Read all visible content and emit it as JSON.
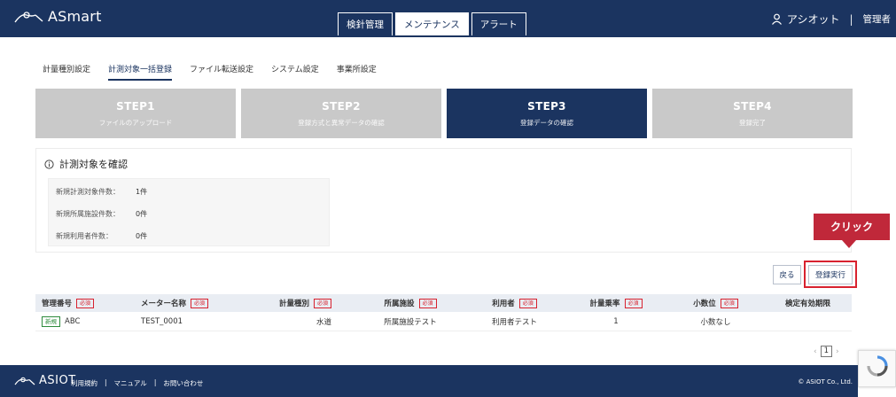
{
  "header": {
    "logo_text": "ASmart",
    "tabs": [
      {
        "label": "検針管理",
        "active": false
      },
      {
        "label": "メンテナンス",
        "active": true
      },
      {
        "label": "アラート",
        "active": false
      }
    ],
    "user_name": "アシオット",
    "separator": "|",
    "user_role": "管理者"
  },
  "subnav": {
    "items": [
      {
        "label": "計量種別設定",
        "active": false
      },
      {
        "label": "計測対象一括登録",
        "active": true
      },
      {
        "label": "ファイル転送設定",
        "active": false
      },
      {
        "label": "システム設定",
        "active": false
      },
      {
        "label": "事業所設定",
        "active": false
      }
    ]
  },
  "steps": [
    {
      "title": "STEP1",
      "subtitle": "ファイルのアップロード",
      "active": false
    },
    {
      "title": "STEP2",
      "subtitle": "登録方式と異常データの確認",
      "active": false
    },
    {
      "title": "STEP3",
      "subtitle": "登録データの確認",
      "active": true
    },
    {
      "title": "STEP4",
      "subtitle": "登録完了",
      "active": false
    }
  ],
  "confirm": {
    "title": "計測対象を確認",
    "rows": [
      {
        "label": "新規計測対象件数：",
        "value": "1件"
      },
      {
        "label": "新規所属施設件数：",
        "value": "0件"
      },
      {
        "label": "新規利用者件数：",
        "value": "0件"
      }
    ]
  },
  "callout": {
    "label": "クリック"
  },
  "actions": {
    "back_label": "戻る",
    "execute_label": "登録実行"
  },
  "table": {
    "required_label": "必須",
    "headers": [
      {
        "label": "管理番号",
        "required": true
      },
      {
        "label": "メーター名称",
        "required": true
      },
      {
        "label": "計量種別",
        "required": true
      },
      {
        "label": "所属施設",
        "required": true
      },
      {
        "label": "利用者",
        "required": true
      },
      {
        "label": "計量乗率",
        "required": true
      },
      {
        "label": "小数位",
        "required": true
      },
      {
        "label": "検定有効期限",
        "required": false
      }
    ],
    "rows": [
      {
        "badge": "新規",
        "cells": [
          "ABC",
          "TEST_0001",
          "水道",
          "所属施設テスト",
          "利用者テスト",
          "1",
          "小数なし",
          ""
        ]
      }
    ]
  },
  "pager": {
    "prev": "‹",
    "current": "1",
    "next": "›"
  },
  "footer": {
    "logo_text": "ASIOT",
    "links": [
      "利用規約",
      "|",
      "マニュアル",
      "|",
      "お問い合わせ"
    ],
    "copyright": "© ASIOT Co., Ltd."
  },
  "colors": {
    "primary": "#1b3460",
    "accent_red": "#c0283a",
    "step_inactive": "#c9c9c9",
    "new_green": "#2e8b3d"
  }
}
